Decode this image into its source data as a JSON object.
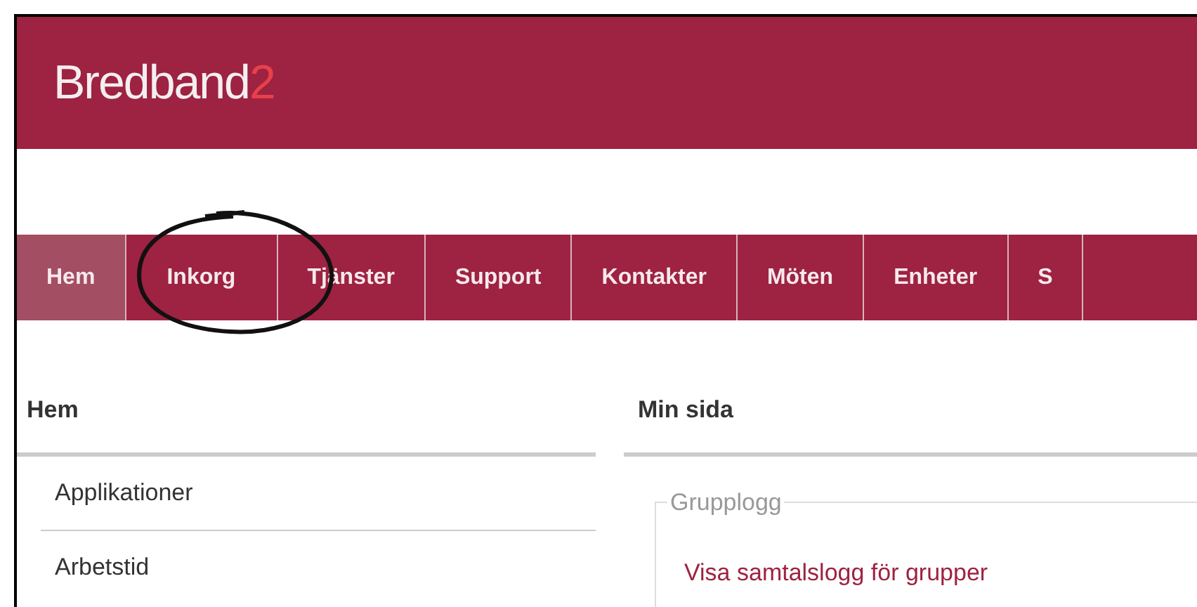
{
  "header": {
    "logo": {
      "text": "Bredband",
      "accent": "2"
    }
  },
  "nav": [
    {
      "label": "Hem",
      "selected": true
    },
    {
      "label": "Inkorg",
      "selected": false
    },
    {
      "label": "Tjänster",
      "selected": false
    },
    {
      "label": "Support",
      "selected": false
    },
    {
      "label": "Kontakter",
      "selected": false
    },
    {
      "label": "Möten",
      "selected": false
    },
    {
      "label": "Enheter",
      "selected": false
    },
    {
      "label": "S",
      "selected": false
    }
  ],
  "sidebar": {
    "title": "Hem",
    "items": [
      "Applikationer",
      "Arbetstid"
    ]
  },
  "main": {
    "title": "Min sida",
    "fieldset": {
      "legend": "Grupplogg",
      "link": "Visa samtalslogg för grupper"
    }
  }
}
